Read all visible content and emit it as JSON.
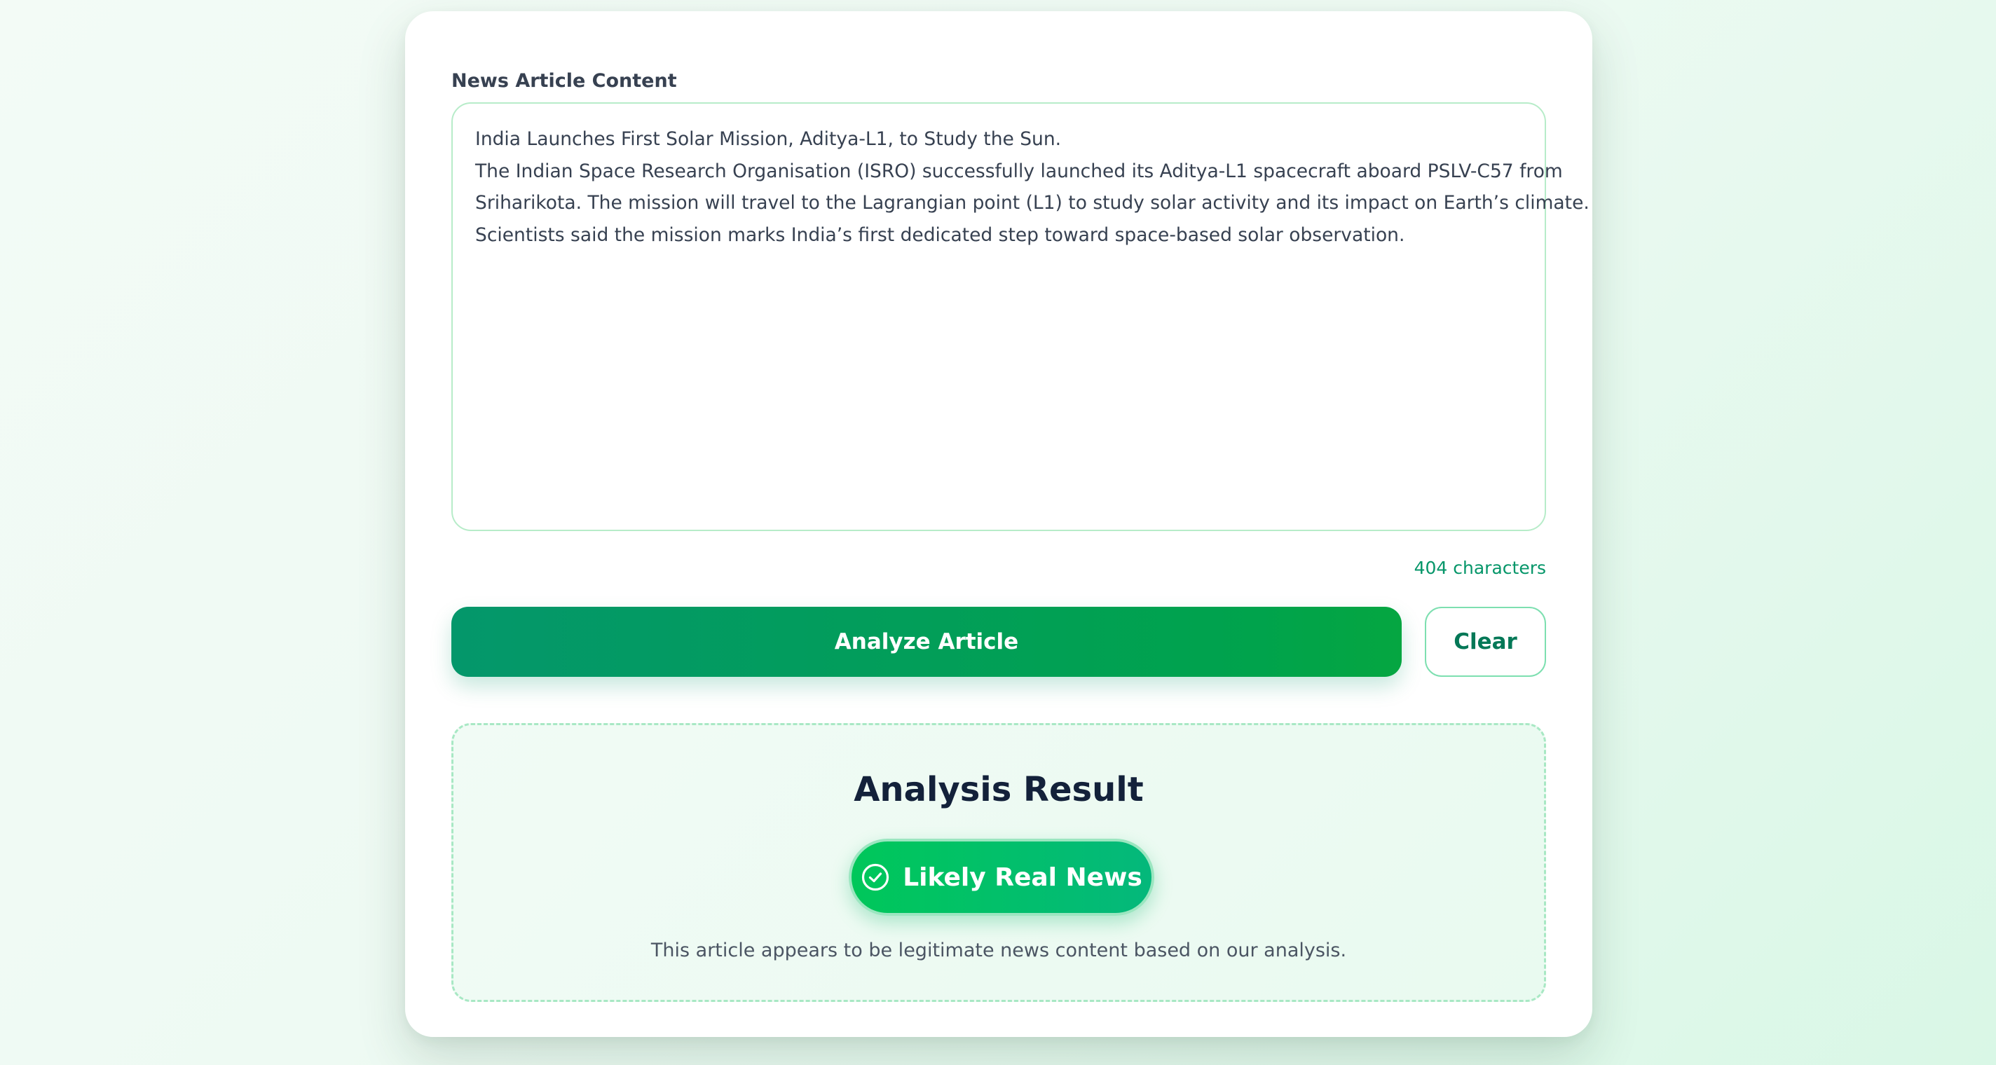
{
  "form": {
    "label": "News Article Content",
    "article_lines": [
      "India Launches First Solar Mission, Aditya-L1, to Study the Sun.",
      "The Indian Space Research Organisation (ISRO) successfully launched its Aditya-L1 spacecraft aboard PSLV-C57 from",
      "Sriharikota. The mission will travel to the Lagrangian point (L1) to study solar activity and its impact on Earth’s climate.",
      "Scientists said the mission marks India’s first dedicated step toward space-based solar observation."
    ],
    "char_count": "404 characters"
  },
  "actions": {
    "analyze_label": "Analyze Article",
    "clear_label": "Clear"
  },
  "result": {
    "title": "Analysis Result",
    "verdict": "Likely Real News",
    "verdict_icon": "check-circle-icon",
    "description": "This article appears to be legitimate news content based on our analysis."
  },
  "colors": {
    "accent": "#059669",
    "button_gradient_start": "#04976b",
    "button_gradient_end": "#05a641",
    "verdict_green": "#00c75a"
  }
}
